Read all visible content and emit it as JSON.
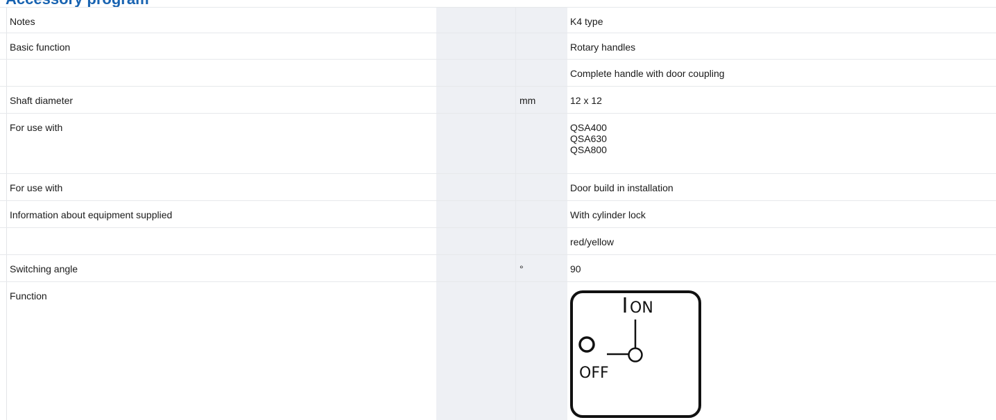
{
  "section": {
    "title": "Accessory program"
  },
  "rows": [
    {
      "label": "Notes",
      "unit": "",
      "value": "K4 type"
    },
    {
      "label": "Basic function",
      "unit": "",
      "value": "Rotary handles"
    },
    {
      "label": "",
      "unit": "",
      "value": "Complete handle with door coupling"
    },
    {
      "label": "Shaft diameter",
      "unit": "mm",
      "value": "12 x 12"
    },
    {
      "label": "For use with",
      "unit": "",
      "values": [
        "QSA400",
        "QSA630",
        "QSA800"
      ]
    },
    {
      "label": "For use with",
      "unit": "",
      "value": "Door build in installation"
    },
    {
      "label": "Information about equipment supplied",
      "unit": "",
      "value": "With cylinder lock"
    },
    {
      "label": "",
      "unit": "",
      "value": "red/yellow"
    },
    {
      "label": "Switching angle",
      "unit": "°",
      "value": "90"
    },
    {
      "label": "Function",
      "unit": "",
      "value": ""
    }
  ],
  "function_diagram": {
    "on_text": "ON",
    "off_text": "OFF",
    "stroke_color": "#111111"
  },
  "colors": {
    "title": "#1863b1",
    "shaded_column": "#eef0f4",
    "row_border": "#e6e8eb"
  }
}
